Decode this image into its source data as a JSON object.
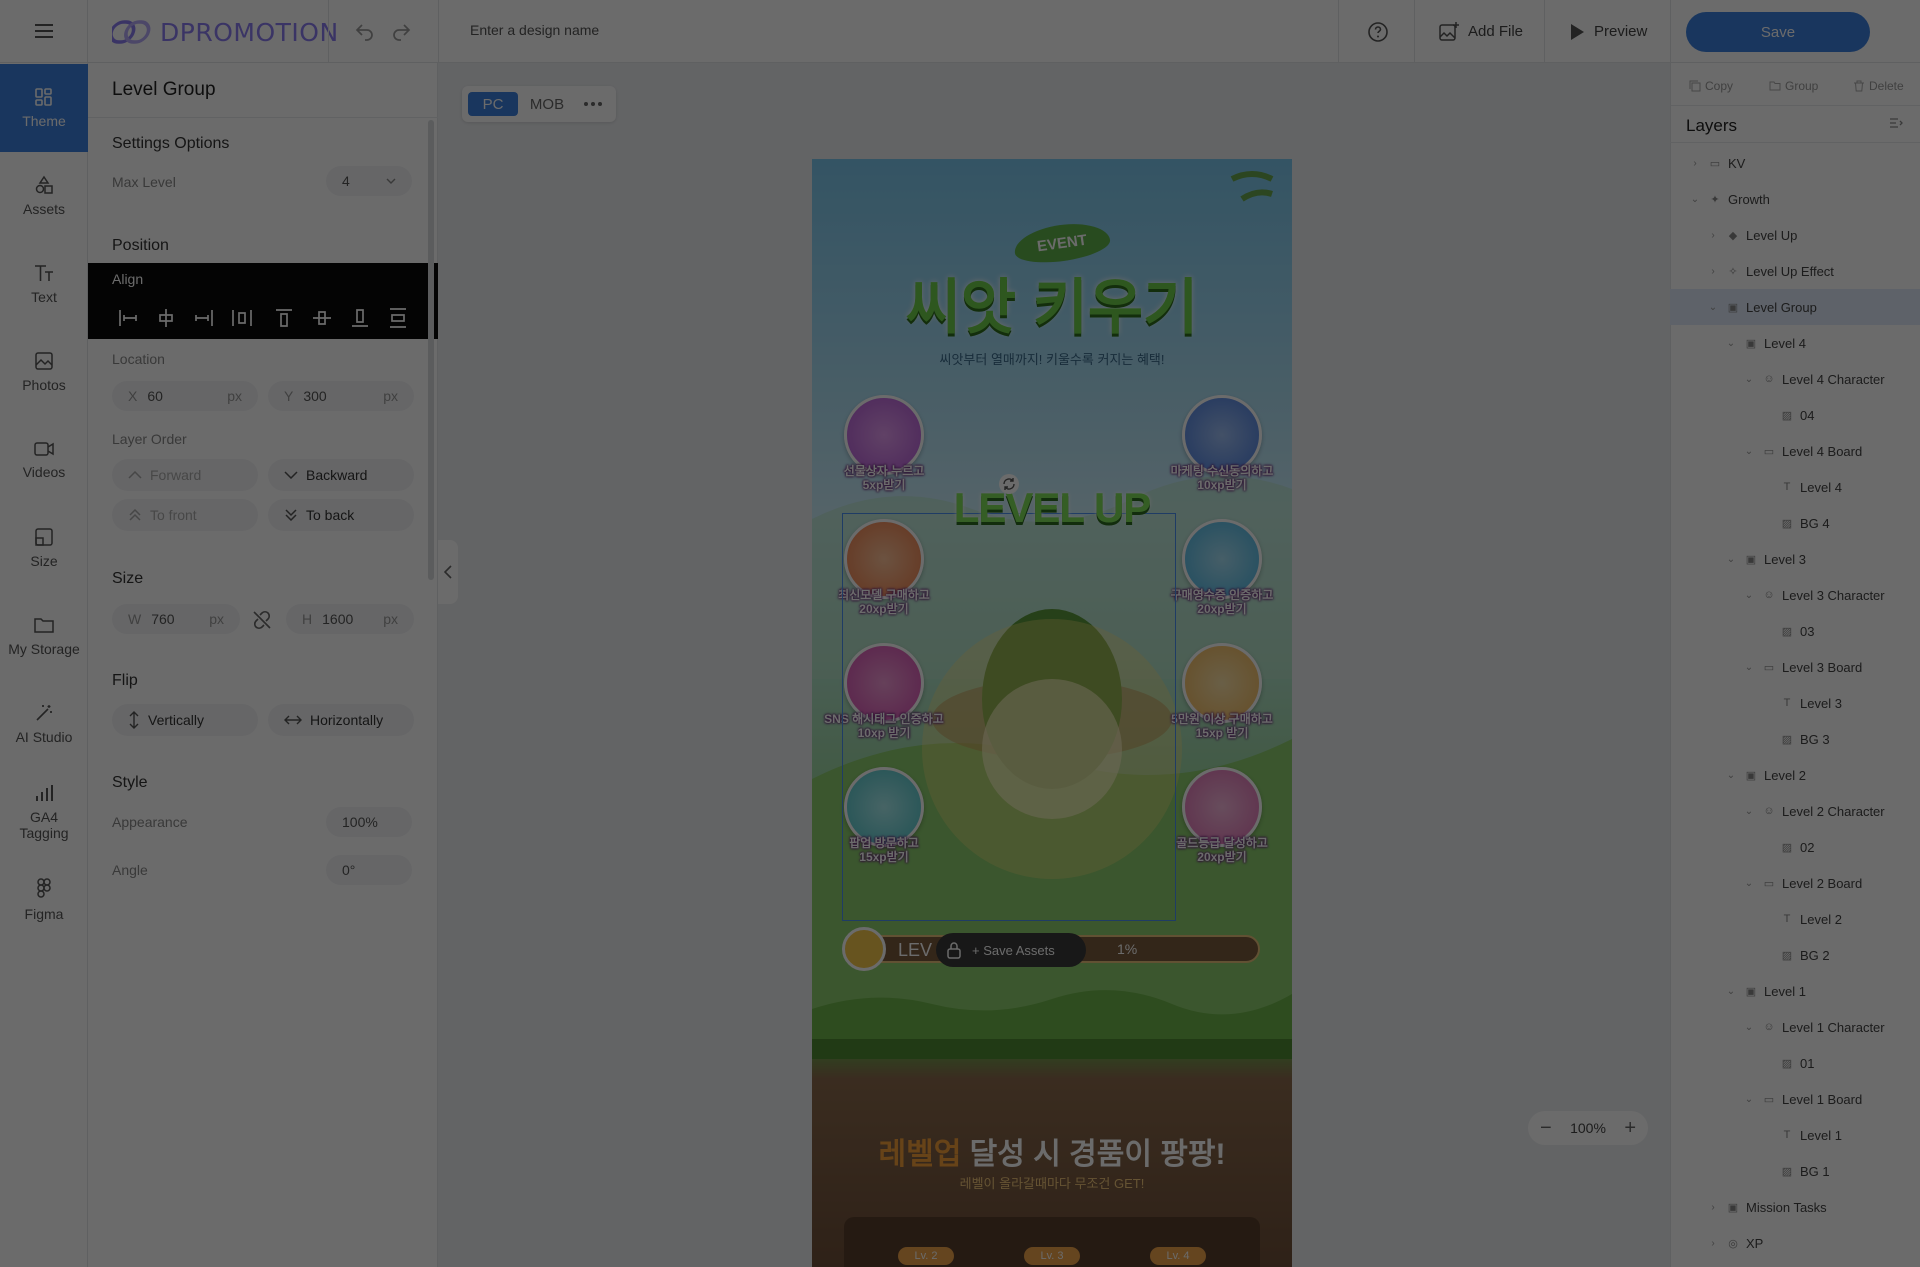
{
  "app": {
    "name": "DPROMOTION"
  },
  "rail": {
    "items": [
      {
        "label": "Theme",
        "icon": "theme-icon"
      },
      {
        "label": "Assets",
        "icon": "assets-icon"
      },
      {
        "label": "Text",
        "icon": "text-icon"
      },
      {
        "label": "Photos",
        "icon": "photos-icon"
      },
      {
        "label": "Videos",
        "icon": "videos-icon"
      },
      {
        "label": "Size",
        "icon": "size-icon"
      },
      {
        "label": "My Storage",
        "icon": "folder-icon"
      },
      {
        "label": "AI Studio",
        "icon": "magic-wand-icon"
      },
      {
        "label": "GA4 Tagging",
        "icon": "bar-chart-icon"
      },
      {
        "label": "Figma",
        "icon": "figma-icon"
      }
    ]
  },
  "topbar": {
    "design_name_placeholder": "Enter a design name",
    "add_file": "Add File",
    "preview": "Preview",
    "save": "Save"
  },
  "panel": {
    "title": "Level Group",
    "settings_options": "Settings Options",
    "max_level_label": "Max Level",
    "max_level_value": "4",
    "position": "Position",
    "align": "Align",
    "location": "Location",
    "x_label": "X",
    "x_value": "60",
    "y_label": "Y",
    "y_value": "300",
    "unit": "px",
    "layer_order": "Layer Order",
    "forward": "Forward",
    "backward": "Backward",
    "to_front": "To front",
    "to_back": "To back",
    "size": "Size",
    "w_label": "W",
    "w_value": "760",
    "h_label": "H",
    "h_value": "1600",
    "flip": "Flip",
    "vertically": "Vertically",
    "horizontally": "Horizontally",
    "style": "Style",
    "appearance_label": "Appearance",
    "appearance_value": "100%",
    "angle_label": "Angle",
    "angle_value": "0°"
  },
  "canvas": {
    "tabs": [
      "PC",
      "MOB"
    ],
    "active_tab": "PC",
    "zoom": "100%",
    "save_assets": "Save Assets",
    "artboard": {
      "event_badge": "EVENT",
      "title": "씨앗 키우기",
      "subtitle": "씨앗부터 열매까지! 키울수록 커지는 혜택!",
      "level_up": "LEVEL UP",
      "progress_label": "LEV",
      "progress_value": "1%",
      "bottom_title_highlight": "레벨업",
      "bottom_title_rest": " 달성 시 경품이 팡팡!",
      "bottom_subtitle": "레벨이 올라갈때마다 무조건 GET!",
      "level_tags": [
        "Lv. 2",
        "Lv. 3",
        "Lv. 4"
      ],
      "missions_left": [
        {
          "line1": "선물상자 누르고",
          "line2": "5xp받기",
          "color": "#b45bd6"
        },
        {
          "line1": "최신모델 구매하고",
          "line2": "20xp받기",
          "color": "#f07f4b"
        },
        {
          "line1": "SNS 해시태그 인증하고",
          "line2": "10xp 받기",
          "color": "#d64fb1"
        },
        {
          "line1": "팝업 방문하고",
          "line2": "15xp받기",
          "color": "#4fc3c8"
        }
      ],
      "missions_right": [
        {
          "line1": "마케팅 수신동의하고",
          "line2": "10xp받기",
          "color": "#4d7fe0"
        },
        {
          "line1": "구매영수증 인증하고",
          "line2": "20xp받기",
          "color": "#4bb6e3"
        },
        {
          "line1": "5만원 이상 구매하고",
          "line2": "15xp 받기",
          "color": "#f2b85a"
        },
        {
          "line1": "골드등급 달성하고",
          "line2": "20xp받기",
          "color": "#e06fb3"
        }
      ]
    }
  },
  "right_panel": {
    "copy": "Copy",
    "group": "Group",
    "delete": "Delete",
    "layers_title": "Layers",
    "layers": [
      {
        "label": "KV",
        "depth": 0,
        "chev": "right",
        "icon": "folder"
      },
      {
        "label": "Growth",
        "depth": 0,
        "chev": "down",
        "icon": "sparkle"
      },
      {
        "label": "Level Up",
        "depth": 1,
        "chev": "right",
        "icon": "gem"
      },
      {
        "label": "Level Up Effect",
        "depth": 1,
        "chev": "right",
        "icon": "effect"
      },
      {
        "label": "Level Group",
        "depth": 1,
        "chev": "down",
        "icon": "group",
        "selected": true
      },
      {
        "label": "Level 4",
        "depth": 2,
        "chev": "down",
        "icon": "group"
      },
      {
        "label": "Level 4 Character",
        "depth": 3,
        "chev": "down",
        "icon": "character"
      },
      {
        "label": "04",
        "depth": 4,
        "chev": "",
        "icon": "image"
      },
      {
        "label": "Level 4 Board",
        "depth": 3,
        "chev": "down",
        "icon": "board"
      },
      {
        "label": "Level 4",
        "depth": 4,
        "chev": "",
        "icon": "text"
      },
      {
        "label": "BG 4",
        "depth": 4,
        "chev": "",
        "icon": "image"
      },
      {
        "label": "Level 3",
        "depth": 2,
        "chev": "down",
        "icon": "group"
      },
      {
        "label": "Level 3 Character",
        "depth": 3,
        "chev": "down",
        "icon": "character"
      },
      {
        "label": "03",
        "depth": 4,
        "chev": "",
        "icon": "image"
      },
      {
        "label": "Level 3 Board",
        "depth": 3,
        "chev": "down",
        "icon": "board"
      },
      {
        "label": "Level 3",
        "depth": 4,
        "chev": "",
        "icon": "text"
      },
      {
        "label": "BG 3",
        "depth": 4,
        "chev": "",
        "icon": "image"
      },
      {
        "label": "Level 2",
        "depth": 2,
        "chev": "down",
        "icon": "group"
      },
      {
        "label": "Level 2 Character",
        "depth": 3,
        "chev": "down",
        "icon": "character"
      },
      {
        "label": "02",
        "depth": 4,
        "chev": "",
        "icon": "image"
      },
      {
        "label": "Level 2 Board",
        "depth": 3,
        "chev": "down",
        "icon": "board"
      },
      {
        "label": "Level 2",
        "depth": 4,
        "chev": "",
        "icon": "text"
      },
      {
        "label": "BG 2",
        "depth": 4,
        "chev": "",
        "icon": "image"
      },
      {
        "label": "Level 1",
        "depth": 2,
        "chev": "down",
        "icon": "group"
      },
      {
        "label": "Level 1 Character",
        "depth": 3,
        "chev": "down",
        "icon": "character"
      },
      {
        "label": "01",
        "depth": 4,
        "chev": "",
        "icon": "image"
      },
      {
        "label": "Level 1 Board",
        "depth": 3,
        "chev": "down",
        "icon": "board"
      },
      {
        "label": "Level 1",
        "depth": 4,
        "chev": "",
        "icon": "text"
      },
      {
        "label": "BG 1",
        "depth": 4,
        "chev": "",
        "icon": "image"
      },
      {
        "label": "Mission Tasks",
        "depth": 1,
        "chev": "right",
        "icon": "group"
      },
      {
        "label": "XP",
        "depth": 1,
        "chev": "right",
        "icon": "xp"
      }
    ]
  },
  "colors": {
    "accent": "#3d82df",
    "logo": "#8b7cf0",
    "selected_layer": "#dfeafb",
    "overlay": "rgba(0,0,0,0.58)"
  }
}
